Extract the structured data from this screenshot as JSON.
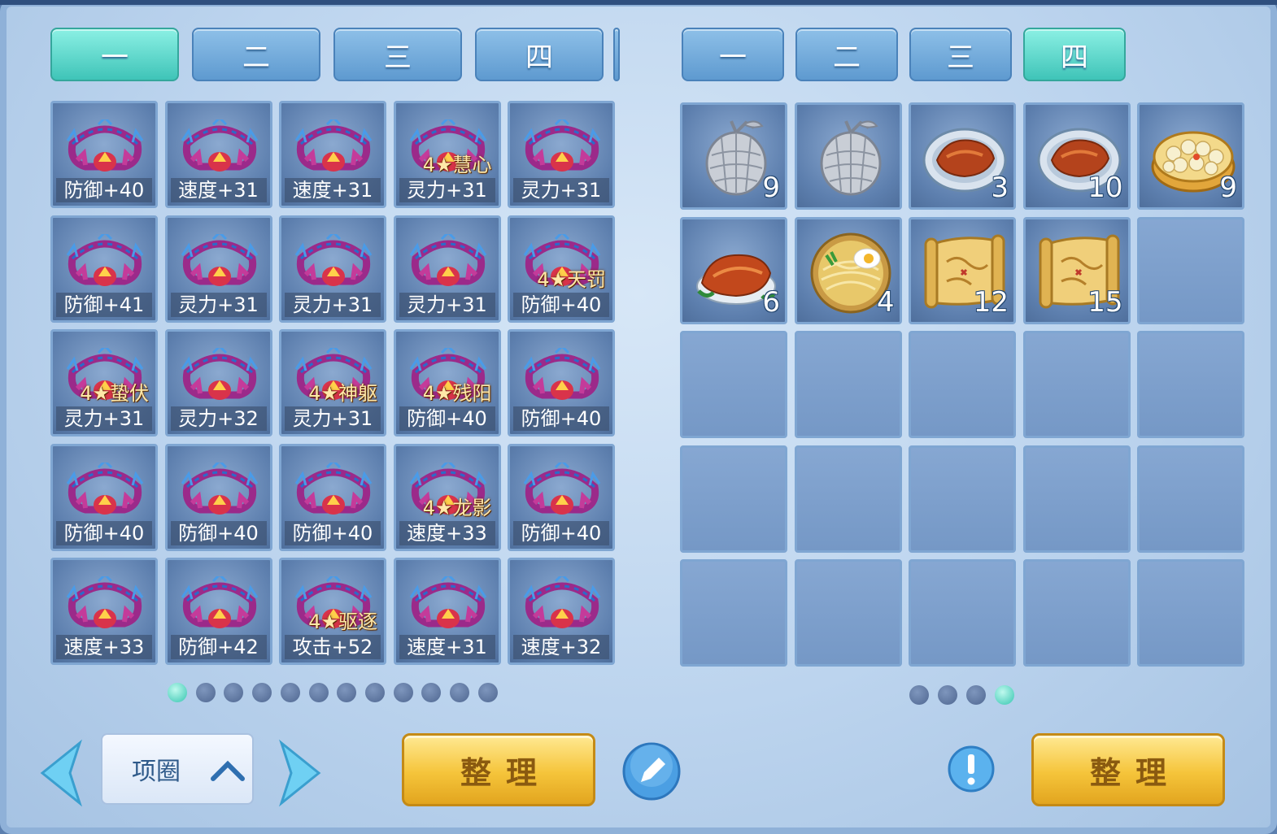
{
  "left_tabs": [
    {
      "label": "一",
      "active": true
    },
    {
      "label": "二",
      "active": false
    },
    {
      "label": "三",
      "active": false
    },
    {
      "label": "四",
      "active": false
    }
  ],
  "right_tabs": [
    {
      "label": "一",
      "active": false
    },
    {
      "label": "二",
      "active": false
    },
    {
      "label": "三",
      "active": false
    },
    {
      "label": "四",
      "active": true
    }
  ],
  "left_grid": [
    [
      {
        "top": "",
        "stat": "防御+40"
      },
      {
        "top": "",
        "stat": "速度+31"
      },
      {
        "top": "",
        "stat": "速度+31"
      },
      {
        "top": "4★慧心",
        "stat": "灵力+31"
      },
      {
        "top": "",
        "stat": "灵力+31"
      }
    ],
    [
      {
        "top": "",
        "stat": "防御+41"
      },
      {
        "top": "",
        "stat": "灵力+31"
      },
      {
        "top": "",
        "stat": "灵力+31"
      },
      {
        "top": "",
        "stat": "灵力+31"
      },
      {
        "top": "4★天罚",
        "stat": "防御+40"
      }
    ],
    [
      {
        "top": "4★蛰伏",
        "stat": "灵力+31"
      },
      {
        "top": "",
        "stat": "灵力+32"
      },
      {
        "top": "4★神躯",
        "stat": "灵力+31"
      },
      {
        "top": "4★残阳",
        "stat": "防御+40"
      },
      {
        "top": "",
        "stat": "防御+40"
      }
    ],
    [
      {
        "top": "",
        "stat": "防御+40"
      },
      {
        "top": "",
        "stat": "防御+40"
      },
      {
        "top": "",
        "stat": "防御+40"
      },
      {
        "top": "4★龙影",
        "stat": "速度+33"
      },
      {
        "top": "",
        "stat": "防御+40"
      }
    ],
    [
      {
        "top": "",
        "stat": "速度+33"
      },
      {
        "top": "",
        "stat": "防御+42"
      },
      {
        "top": "4★驱逐",
        "stat": "攻击+52"
      },
      {
        "top": "",
        "stat": "速度+31"
      },
      {
        "top": "",
        "stat": "速度+32"
      }
    ]
  ],
  "right_grid": [
    [
      {
        "icon": "silver-fruit-icon",
        "count": "9"
      },
      {
        "icon": "silver-fruit-icon",
        "count": ""
      },
      {
        "icon": "roast-chicken-plate-icon",
        "count": "3"
      },
      {
        "icon": "roast-chicken-plate-icon",
        "count": "10"
      },
      {
        "icon": "steamed-buns-icon",
        "count": "9"
      }
    ],
    [
      {
        "icon": "roast-duck-icon",
        "count": "6"
      },
      {
        "icon": "noodle-bowl-icon",
        "count": "4"
      },
      {
        "icon": "treasure-map-icon",
        "count": "12"
      },
      {
        "icon": "treasure-map-icon",
        "count": "15"
      },
      {
        "icon": "",
        "count": ""
      }
    ],
    [
      {
        "icon": "",
        "count": ""
      },
      {
        "icon": "",
        "count": ""
      },
      {
        "icon": "",
        "count": ""
      },
      {
        "icon": "",
        "count": ""
      },
      {
        "icon": "",
        "count": ""
      }
    ],
    [
      {
        "icon": "",
        "count": ""
      },
      {
        "icon": "",
        "count": ""
      },
      {
        "icon": "",
        "count": ""
      },
      {
        "icon": "",
        "count": ""
      },
      {
        "icon": "",
        "count": ""
      }
    ],
    [
      {
        "icon": "",
        "count": ""
      },
      {
        "icon": "",
        "count": ""
      },
      {
        "icon": "",
        "count": ""
      },
      {
        "icon": "",
        "count": ""
      },
      {
        "icon": "",
        "count": ""
      }
    ]
  ],
  "left_pages": {
    "total": 12,
    "current": 1
  },
  "right_pages": {
    "total": 4,
    "current": 4
  },
  "category_select": {
    "value": "项圈"
  },
  "left_sort_label": "整理",
  "right_sort_label": "整理",
  "colors": {
    "active_tab": "#3fc4b8",
    "tab": "#5e9ad0",
    "button": "#f5c43a"
  }
}
